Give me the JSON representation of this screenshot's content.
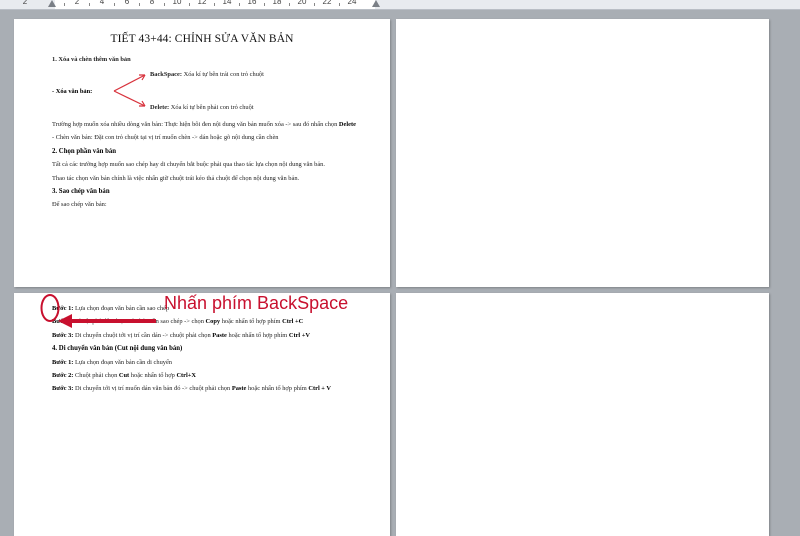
{
  "ruler": {
    "numbers": [
      "2",
      "2",
      "4",
      "6",
      "8",
      "10",
      "12",
      "14",
      "16",
      "18",
      "20",
      "22",
      "24"
    ]
  },
  "page1": {
    "title": "TIẾT 43+44: CHỈNH SỬA VĂN BẢN",
    "h1": "1. Xóa và chèn thêm văn bản",
    "xoa_label": "- Xóa  văn bản:",
    "backspace_key": "BackSpace:",
    "backspace_desc": "Xóa kí tự bên trái con trỏ chuột",
    "delete_key": "Delete:",
    "delete_desc": "Xóa kí tự bên phải con trỏ chuột",
    "para1_text": "Trường hợp muốn xóa nhiều dòng văn bản: Thực hiện bôi đen nội dung văn bản muốn xóa -> sau đó nhấn chọn",
    "para1_key": "Delete",
    "para2": "- Chèn văn bản: Đặt con trỏ chuột tại vị trí muốn chèn -> dán hoặc gõ nội dung cần chèn",
    "h2": "2. Chọn phần văn bản",
    "para3": "Tất cả các trường hợp muốn sao chép hay di chuyển bắt buộc phải qua thao tác lựa chọn nội dung văn bản.",
    "para4": "Thao tác chọn văn bản chính là việc nhấn giữ chuột trái kéo thả chuột để chọn nội dung văn bản.",
    "h3": "3. Sao chép văn bản",
    "para5": "Để sao chép văn bản:"
  },
  "page3": {
    "s1_label": "Bước 1:",
    "s1_text": "Lựa chọn đoạn văn bản cần sao chép",
    "s2_label": "Bước 2:",
    "s2_text1": "Chuột phải lên đoạn văn bản cần sao chép -> chọn",
    "s2_copy": "Copy",
    "s2_text2": "hoặc nhấn tổ hợp phím",
    "s2_keys": "Ctrl +C",
    "s3_label": "Bước 3:",
    "s3_text1": "Di chuyển chuột tới vị trí cần dán -> chuột phải chọn",
    "s3_paste": "Paste",
    "s3_text2": "hoặc nhấn tổ hợp phím",
    "s3_keys": "Ctrl +V",
    "h4": "4. Di chuyển văn bản (Cut nội dung văn bản)",
    "m1_label": "Bước 1:",
    "m1_text": "Lựa chọn đoạn văn bản cần di chuyển",
    "m2_label": "Bước 2:",
    "m2_text": "Chuột phải chọn",
    "m2_cut": "Cut",
    "m2_text2": "hoặc nhấn tổ hợp",
    "m2_keys": "Ctrl+X",
    "m3_label": "Bước 3:",
    "m3_text1": "Di chuyển tới vị trí muốn dán văn bản đó -> chuột phải chọn",
    "m3_paste": "Paste",
    "m3_text2": "hoặc nhấn tổ hợp phím",
    "m3_keys": "Ctrl + V"
  },
  "annotation": {
    "text": "Nhấn phím BackSpace",
    "color": "#c8102e"
  }
}
